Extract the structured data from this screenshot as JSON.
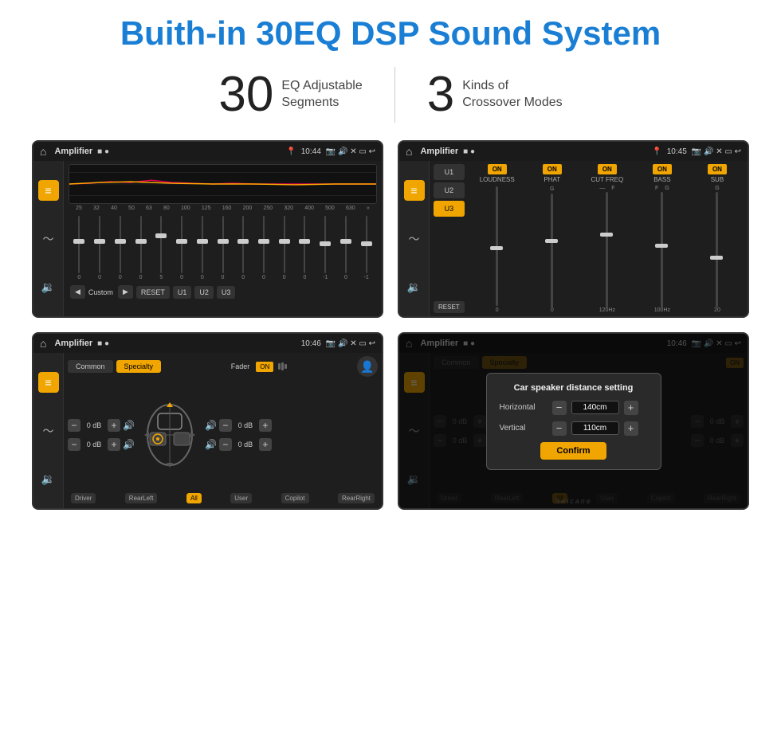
{
  "header": {
    "title": "Buith-in 30EQ DSP Sound System"
  },
  "stats": [
    {
      "number": "30",
      "label_line1": "EQ Adjustable",
      "label_line2": "Segments"
    },
    {
      "number": "3",
      "label_line1": "Kinds of",
      "label_line2": "Crossover Modes"
    }
  ],
  "screens": [
    {
      "id": "eq-screen",
      "status_bar": {
        "title": "Amplifier",
        "time": "10:44"
      },
      "type": "equalizer"
    },
    {
      "id": "crossover-screen",
      "status_bar": {
        "title": "Amplifier",
        "time": "10:45"
      },
      "type": "crossover"
    },
    {
      "id": "specialty-screen",
      "status_bar": {
        "title": "Amplifier",
        "time": "10:46"
      },
      "type": "specialty"
    },
    {
      "id": "distance-screen",
      "status_bar": {
        "title": "Amplifier",
        "time": "10:46"
      },
      "type": "distance",
      "dialog": {
        "title": "Car speaker distance setting",
        "horizontal_label": "Horizontal",
        "horizontal_value": "140cm",
        "vertical_label": "Vertical",
        "vertical_value": "110cm",
        "confirm_label": "Confirm"
      }
    }
  ],
  "eq": {
    "frequencies": [
      "25",
      "32",
      "40",
      "50",
      "63",
      "80",
      "100",
      "125",
      "160",
      "200",
      "250",
      "320",
      "400",
      "500",
      "630"
    ],
    "values": [
      "0",
      "0",
      "0",
      "0",
      "5",
      "0",
      "0",
      "0",
      "0",
      "0",
      "0",
      "0",
      "-1",
      "0",
      "-1"
    ],
    "bottom_controls": {
      "prev": "◀",
      "label": "Custom",
      "next": "▶",
      "reset": "RESET",
      "u1": "U1",
      "u2": "U2",
      "u3": "U3"
    }
  },
  "crossover": {
    "presets": [
      "U1",
      "U2",
      "U3"
    ],
    "active_preset": "U3",
    "channels": [
      "LOUDNESS",
      "PHAT",
      "CUT FREQ",
      "BASS",
      "SUB"
    ],
    "reset": "RESET"
  },
  "specialty": {
    "tabs": [
      "Common",
      "Specialty"
    ],
    "active_tab": "Specialty",
    "fader_label": "Fader",
    "fader_on": "ON",
    "speakers": {
      "front_left": "0 dB",
      "front_right": "0 dB",
      "rear_left": "0 dB",
      "rear_right": "0 dB"
    },
    "labels": [
      "Driver",
      "RearLeft",
      "All",
      "User",
      "Copilot",
      "RearRight"
    ]
  },
  "distance_dialog": {
    "title": "Car speaker distance setting",
    "horizontal": "140cm",
    "vertical": "110cm",
    "confirm": "Confirm"
  },
  "watermark": "Seicane"
}
